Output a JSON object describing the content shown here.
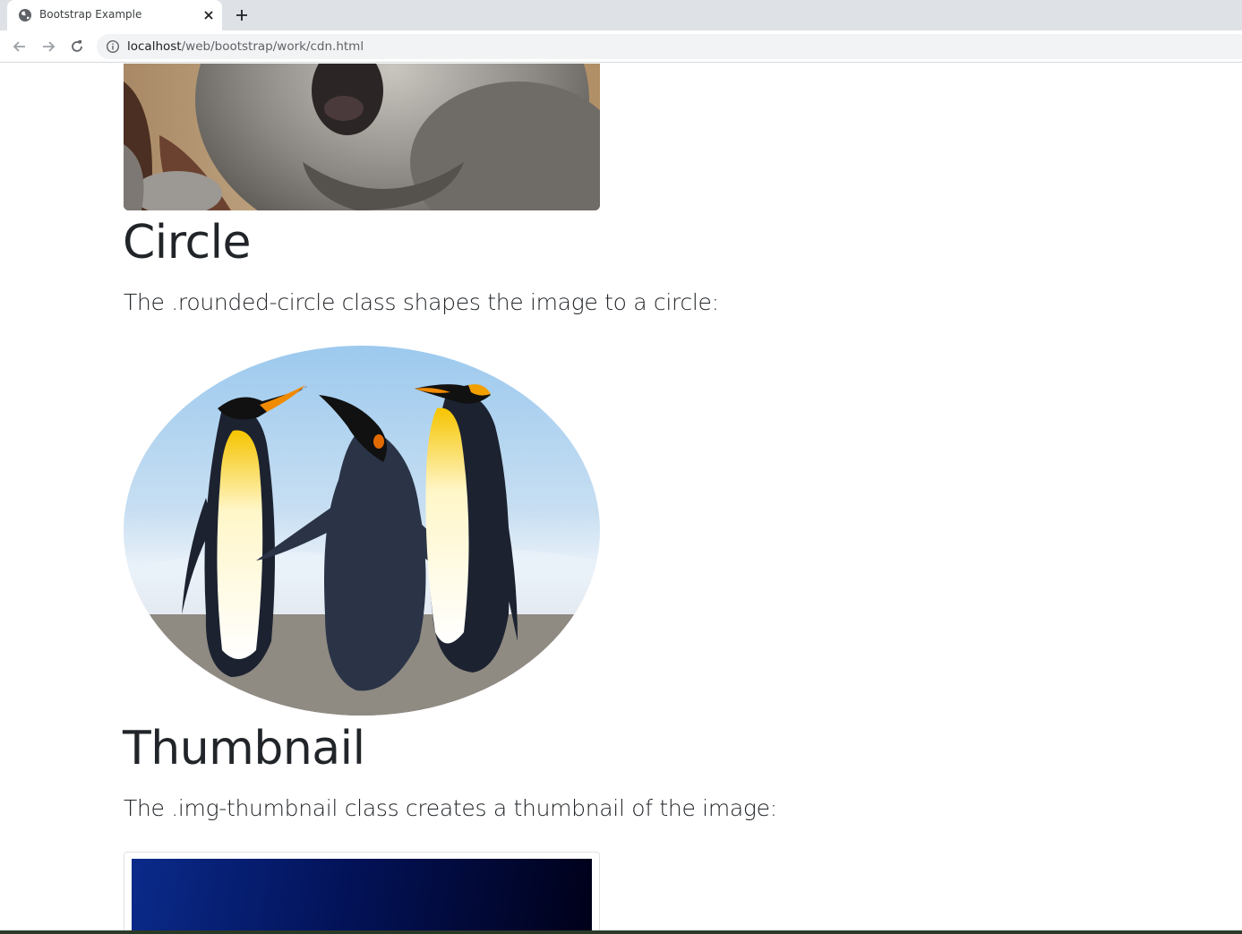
{
  "browser": {
    "tab_title": "Bootstrap Example",
    "url_host": "localhost",
    "url_path": "/web/bootstrap/work/cdn.html"
  },
  "sections": [
    {
      "heading": "Circle",
      "text": "The .rounded-circle class shapes the image to a circle:"
    },
    {
      "heading": "Thumbnail",
      "text": "The .img-thumbnail class creates a thumbnail of the image:"
    }
  ]
}
